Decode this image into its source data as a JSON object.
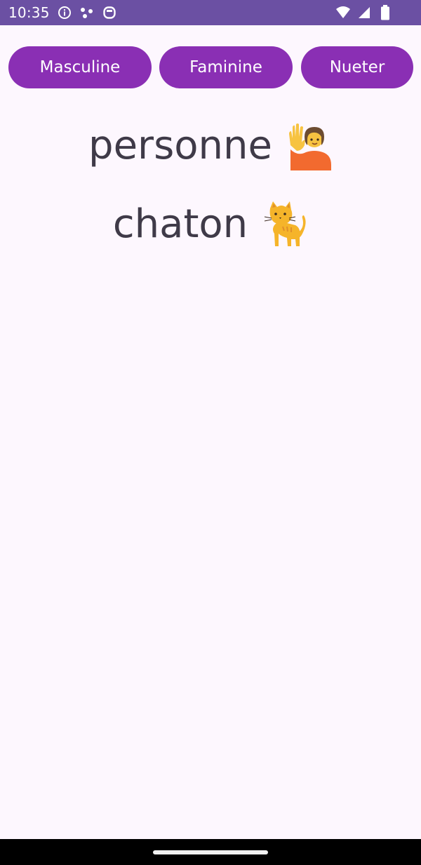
{
  "status_bar": {
    "time": "10:35",
    "left_icons": [
      "info-icon",
      "dots-icon",
      "sync-icon"
    ],
    "right_icons": [
      "wifi-icon",
      "signal-icon",
      "battery-icon"
    ],
    "background": "#6b50a3"
  },
  "buttons": [
    {
      "label": "Masculine"
    },
    {
      "label": "Faminine"
    },
    {
      "label": "Nueter"
    }
  ],
  "button_color": "#8a2fb4",
  "words": [
    {
      "text": "personne",
      "emoji": "person-raising-hand-icon"
    },
    {
      "text": "chaton",
      "emoji": "cat-icon"
    }
  ],
  "colors": {
    "background": "#fdf7fe",
    "word_text": "#3f3a48",
    "nav_bar": "#000000"
  }
}
